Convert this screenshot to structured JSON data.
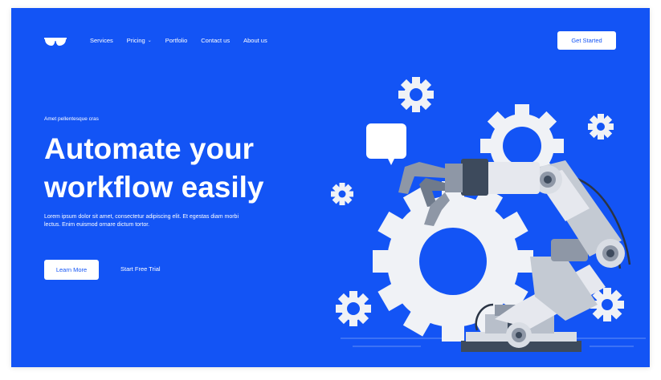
{
  "nav": {
    "items": [
      {
        "label": "Services"
      },
      {
        "label": "Pricing",
        "has_dropdown": true
      },
      {
        "label": "Portfolio"
      },
      {
        "label": "Contact us"
      },
      {
        "label": "About us"
      }
    ],
    "cta_label": "Get Started"
  },
  "hero": {
    "eyebrow": "Amet pellentesque cras",
    "headline_line1": "Automate your",
    "headline_line2": "workflow easily",
    "description": "Lorem ipsum dolor sit amet, consectetur adipiscing elit. Et egestas diam morbi lectus. Enim euismod ornare dictum tortor.",
    "primary_button": "Learn More",
    "secondary_button": "Start Free Trial"
  },
  "colors": {
    "background": "#1354f5",
    "button_bg": "#ffffff",
    "button_text": "#1354f5",
    "gear": "#f0f2f6",
    "robot_dark": "#3d4a5c"
  },
  "icons": {
    "logo": "sunglasses-icon",
    "chevron": "chevron-down-icon",
    "speech": "speech-bubble-icon"
  }
}
